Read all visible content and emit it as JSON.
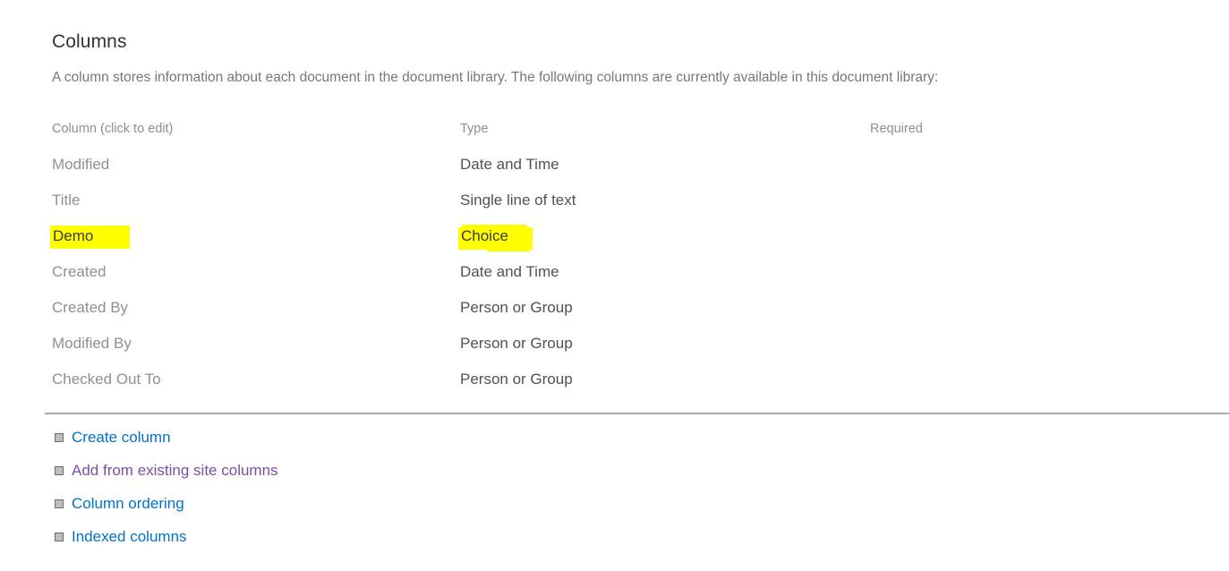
{
  "section": {
    "title": "Columns",
    "description": "A column stores information about each document in the document library. The following columns are currently available in this document library:"
  },
  "table": {
    "headers": {
      "column": "Column (click to edit)",
      "type": "Type",
      "required": "Required"
    },
    "rows": [
      {
        "column": "Modified",
        "type": "Date and Time",
        "required": "",
        "highlighted": false
      },
      {
        "column": "Title",
        "type": "Single line of text",
        "required": "",
        "highlighted": false
      },
      {
        "column": "Demo",
        "type": "Choice",
        "required": "",
        "highlighted": true
      },
      {
        "column": "Created",
        "type": "Date and Time",
        "required": "",
        "highlighted": false
      },
      {
        "column": "Created By",
        "type": "Person or Group",
        "required": "",
        "highlighted": false
      },
      {
        "column": "Modified By",
        "type": "Person or Group",
        "required": "",
        "highlighted": false
      },
      {
        "column": "Checked Out To",
        "type": "Person or Group",
        "required": "",
        "highlighted": false
      }
    ]
  },
  "actions": {
    "items": [
      {
        "label": "Create column",
        "icon": "small-square-bullet-icon",
        "visited": false
      },
      {
        "label": "Add from existing site columns",
        "icon": "small-square-bullet-icon",
        "visited": true
      },
      {
        "label": "Column ordering",
        "icon": "small-square-bullet-icon",
        "visited": false
      },
      {
        "label": "Indexed columns",
        "icon": "small-square-bullet-icon",
        "visited": false
      }
    ]
  },
  "colors": {
    "link": "#0072c6",
    "link_visited": "#7a4ea6",
    "highlight": "#ffff00",
    "divider": "#aaaaaa",
    "heading_text": "#333333",
    "body_text": "#777777"
  }
}
